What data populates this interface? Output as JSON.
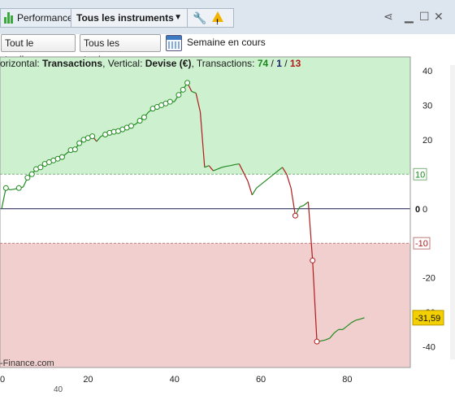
{
  "tabs": {
    "performance": "Performance",
    "instruments": "Tous les instruments"
  },
  "toolbar": {
    "trading_filter": "Tout le trading",
    "trades_filter": "Tous les trades",
    "period": "Semaine en cours"
  },
  "info": {
    "prefix": "orizontal: ",
    "horizontal": "Transactions",
    "sep1": ", Vertical: ",
    "vertical": "Devise (€)",
    "sep2": ", Transactions: ",
    "count_green": "74",
    "slash1": " / ",
    "count_neutral": "1",
    "slash2": " / ",
    "count_red": "13"
  },
  "watermark": "-Finance.com",
  "colors": {
    "profit_zone": "#cdf0cf",
    "loss_zone": "#f2cfcf",
    "up_line": "#1f8a1f",
    "down_line": "#b01c1c",
    "last_value_bg": "#f4d000"
  },
  "chart_data": {
    "type": "line",
    "xlabel": "",
    "ylabel": "",
    "xlim": [
      0,
      95
    ],
    "ylim": [
      -46,
      44
    ],
    "x_ticks": [
      0,
      20,
      40,
      60,
      80
    ],
    "y_ticks": [
      40,
      30,
      20,
      0,
      -20,
      -30,
      -40
    ],
    "thresholds": [
      10,
      -10
    ],
    "threshold_labels": [
      "10",
      "-10"
    ],
    "zero_label": "0",
    "last_value_label": "-31,59",
    "lower_tick_label": "40",
    "points": [
      [
        0,
        0
      ],
      [
        1,
        6
      ],
      [
        2,
        5.5
      ],
      [
        3,
        5.7
      ],
      [
        4,
        6
      ],
      [
        5,
        6.3
      ],
      [
        6,
        9
      ],
      [
        7,
        10
      ],
      [
        8,
        11.5
      ],
      [
        9,
        12
      ],
      [
        10,
        13
      ],
      [
        11,
        13.5
      ],
      [
        12,
        14
      ],
      [
        13,
        14.5
      ],
      [
        14,
        15
      ],
      [
        15,
        16
      ],
      [
        16,
        17
      ],
      [
        17,
        17.2
      ],
      [
        18,
        19
      ],
      [
        19,
        20
      ],
      [
        20,
        20.5
      ],
      [
        21,
        21
      ],
      [
        22,
        19.5
      ],
      [
        23,
        21
      ],
      [
        24,
        21.5
      ],
      [
        25,
        22
      ],
      [
        26,
        22.3
      ],
      [
        27,
        22.5
      ],
      [
        28,
        23
      ],
      [
        29,
        23.5
      ],
      [
        30,
        24
      ],
      [
        31,
        24.5
      ],
      [
        32,
        25.5
      ],
      [
        33,
        26.5
      ],
      [
        34,
        28
      ],
      [
        35,
        29
      ],
      [
        36,
        29.5
      ],
      [
        37,
        30
      ],
      [
        38,
        30.5
      ],
      [
        39,
        31
      ],
      [
        40,
        31
      ],
      [
        41,
        33
      ],
      [
        42,
        34.5
      ],
      [
        43,
        36.5
      ],
      [
        44,
        34
      ],
      [
        45,
        33.5
      ],
      [
        46,
        28
      ],
      [
        47,
        12
      ],
      [
        48,
        12.5
      ],
      [
        49,
        11
      ],
      [
        50,
        11.5
      ],
      [
        51,
        12
      ],
      [
        52,
        12.3
      ],
      [
        53,
        12.5
      ],
      [
        54,
        12.8
      ],
      [
        55,
        13
      ],
      [
        56,
        10.5
      ],
      [
        57,
        8
      ],
      [
        58,
        4
      ],
      [
        59,
        6
      ],
      [
        60,
        7
      ],
      [
        61,
        8
      ],
      [
        62,
        9
      ],
      [
        63,
        10
      ],
      [
        64,
        11
      ],
      [
        65,
        12
      ],
      [
        66,
        10
      ],
      [
        67,
        6
      ],
      [
        68,
        -2
      ],
      [
        69,
        0.5
      ],
      [
        70,
        1
      ],
      [
        71,
        2
      ],
      [
        72,
        -15
      ],
      [
        73,
        -38.5
      ],
      [
        74,
        -38.3
      ],
      [
        75,
        -38
      ],
      [
        76,
        -37.5
      ],
      [
        77,
        -36
      ],
      [
        78,
        -35
      ],
      [
        79,
        -35
      ],
      [
        80,
        -34
      ],
      [
        81,
        -33
      ],
      [
        82,
        -32.3
      ],
      [
        83,
        -32
      ],
      [
        84,
        -31.59
      ]
    ],
    "markers_green_x": [
      1,
      4,
      6,
      7,
      8,
      9,
      10,
      11,
      12,
      13,
      14,
      16,
      17,
      18,
      19,
      20,
      21,
      24,
      25,
      26,
      27,
      28,
      29,
      30,
      32,
      33,
      35,
      36,
      37,
      38,
      39,
      41,
      42,
      43
    ],
    "markers_red_x": [
      68,
      72,
      73
    ]
  }
}
